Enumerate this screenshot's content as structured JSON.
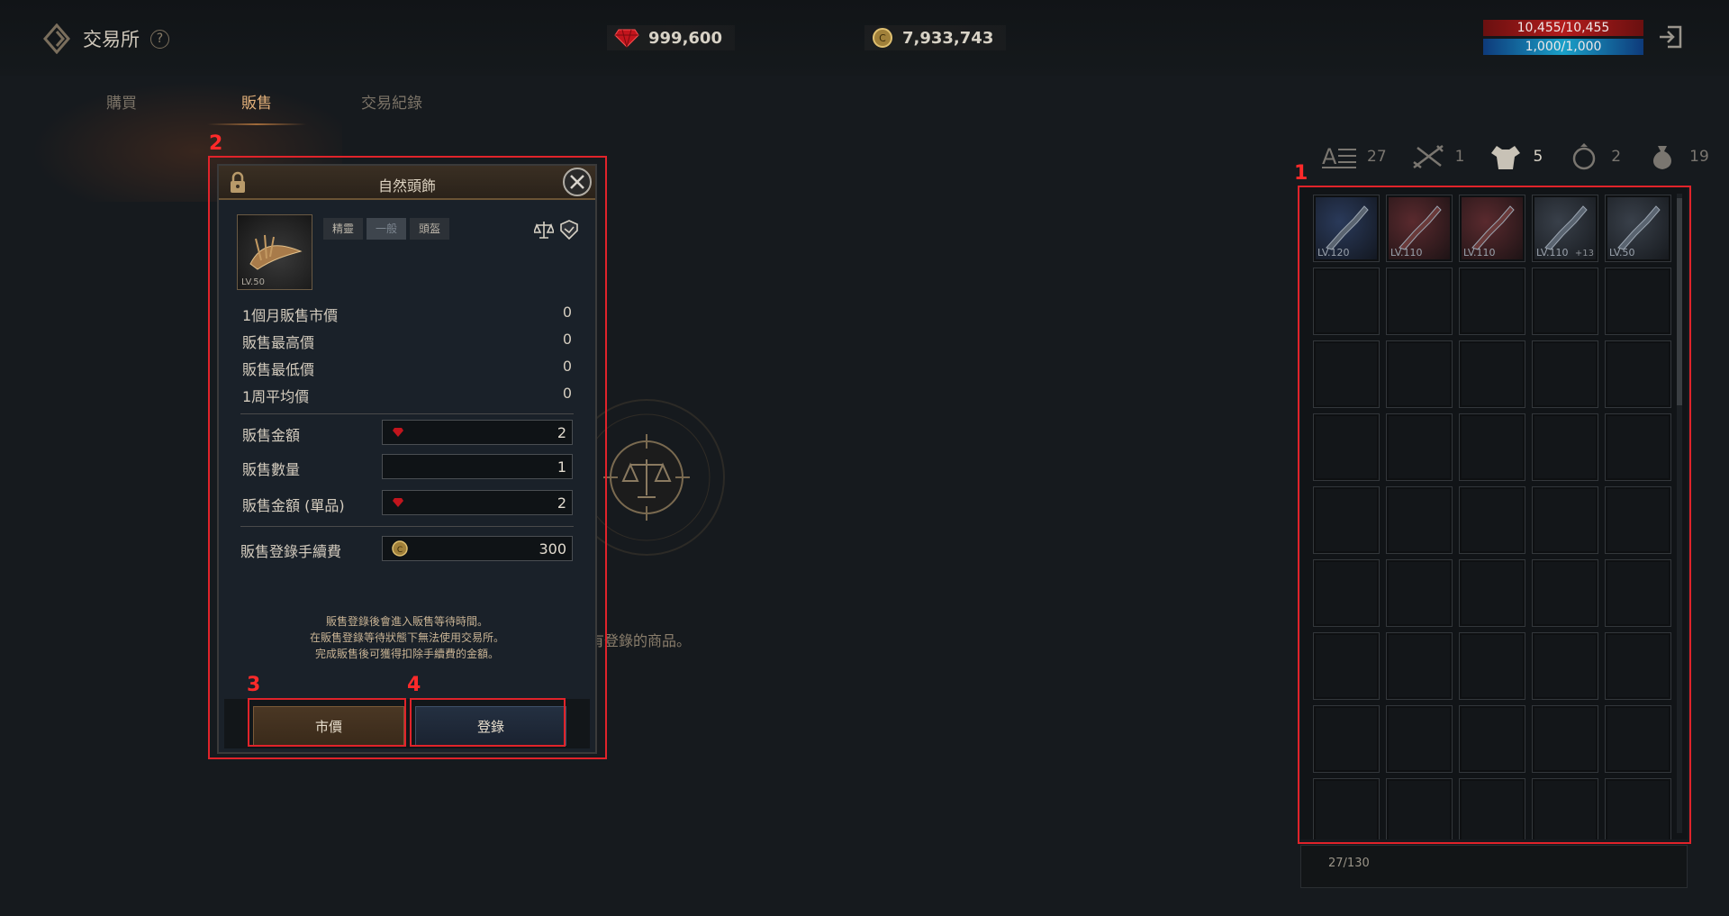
{
  "header": {
    "title": "交易所",
    "help_icon": "question-mark-icon",
    "diamonds": "999,600",
    "gold": "7,933,743",
    "hp": "10,455/10,455",
    "mp": "1,000/1,000",
    "colors": {
      "hp": "#b21c1c",
      "mp": "#1aa0c8",
      "accent": "#e2b07a",
      "highlight": "#e0232a"
    }
  },
  "tabs": [
    {
      "label": "購買",
      "active": false
    },
    {
      "label": "販售",
      "active": true
    },
    {
      "label": "交易紀錄",
      "active": false
    }
  ],
  "empty_message": "有登錄的商品。",
  "annotations": [
    "1",
    "2",
    "3",
    "4"
  ],
  "sell_panel": {
    "item_name": "自然頭飾",
    "item_level": "LV.50",
    "filters": [
      "精靈",
      "一般",
      "頭盔"
    ],
    "selected_filter": "一般",
    "stats": [
      {
        "label": "1個月販售市價",
        "value": "0"
      },
      {
        "label": "販售最高價",
        "value": "0"
      },
      {
        "label": "販售最低價",
        "value": "0"
      },
      {
        "label": "1周平均價",
        "value": "0"
      }
    ],
    "price_label": "販售金額",
    "price_value": "2",
    "qty_label": "販售數量",
    "qty_value": "1",
    "unit_label": "販售金額 (單品)",
    "unit_value": "2",
    "fee_label": "販售登錄手續費",
    "fee_value": "300",
    "notice": [
      "販售登錄後會進入販售等待時間。",
      "在販售登錄等待狀態下無法使用交易所。",
      "完成販售後可獲得扣除手續費的金額。"
    ],
    "btn_market": "市價",
    "btn_register": "登錄"
  },
  "inventory": {
    "categories": [
      {
        "icon": "all-items-icon",
        "count": "27",
        "active": false
      },
      {
        "icon": "weapon-icon",
        "count": "1",
        "active": false
      },
      {
        "icon": "armor-icon",
        "count": "5",
        "active": true
      },
      {
        "icon": "ring-icon",
        "count": "2",
        "active": false
      },
      {
        "icon": "pouch-icon",
        "count": "19",
        "active": false
      }
    ],
    "items": [
      {
        "level": "LV.120",
        "style": "blue",
        "plus": ""
      },
      {
        "level": "LV.110",
        "style": "red",
        "plus": ""
      },
      {
        "level": "LV.110",
        "style": "red",
        "plus": ""
      },
      {
        "level": "LV.110",
        "style": "filled",
        "plus": "+13"
      },
      {
        "level": "LV.50",
        "style": "filled",
        "plus": ""
      }
    ],
    "capacity": "27/130"
  }
}
